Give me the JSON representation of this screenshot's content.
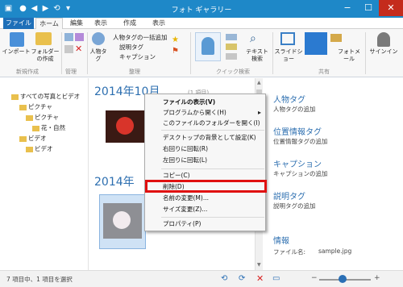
{
  "window": {
    "title": "フォト ギャラリー",
    "min": "−",
    "max": "☐",
    "close": "✕"
  },
  "tabs": [
    "ファイル",
    "ホーム",
    "編集",
    "表示",
    "作成",
    "表示"
  ],
  "ribbon": {
    "groups": [
      "新規作成",
      "管理",
      "整理",
      "クイック検索",
      "共有"
    ],
    "import_label": "インポート",
    "folder_label": "フォルダーの作成",
    "people_label": "人物タグ",
    "add_people_tag": "人物タグの一括追加",
    "caption_tag": "説明タグ",
    "caption": "キャプション",
    "text_search": "テキスト検索",
    "slideshow": "スライドショー",
    "photo_mail": "フォトメール",
    "signin": "サインイン"
  },
  "nav": {
    "items": [
      "すべての写真とビデオ",
      "ピクチャ",
      "ピクチャ",
      "花・自然",
      "ビデオ",
      "ビデオ"
    ]
  },
  "main": {
    "date1": "2014年10月",
    "count1": "(1 項目)",
    "date2": "2014年"
  },
  "context_menu": {
    "items": [
      "ファイルの表示(V)",
      "プログラムから開く(H)",
      "このファイルのフォルダーを開く(I)",
      "デスクトップの背景として設定(K)",
      "右回りに回転(R)",
      "左回りに回転(L)",
      "コピー(C)",
      "削除(D)",
      "名前の変更(M)...",
      "サイズ変更(Z)...",
      "プロパティ(P)"
    ],
    "submenu_arrow": "▸"
  },
  "detail": {
    "people_head": "人物タグ",
    "people_sub": "人物タグの追加",
    "geo_head": "位置情報タグ",
    "geo_sub": "位置情報タグの追加",
    "caption_head": "キャプション",
    "caption_sub": "キャプションの追加",
    "desc_head": "説明タグ",
    "desc_sub": "説明タグの追加",
    "info_head": "情報",
    "file_label": "ファイル名:",
    "file_value": "sample.jpg"
  },
  "status": {
    "text": "7 項目中、1 項目を選択"
  }
}
